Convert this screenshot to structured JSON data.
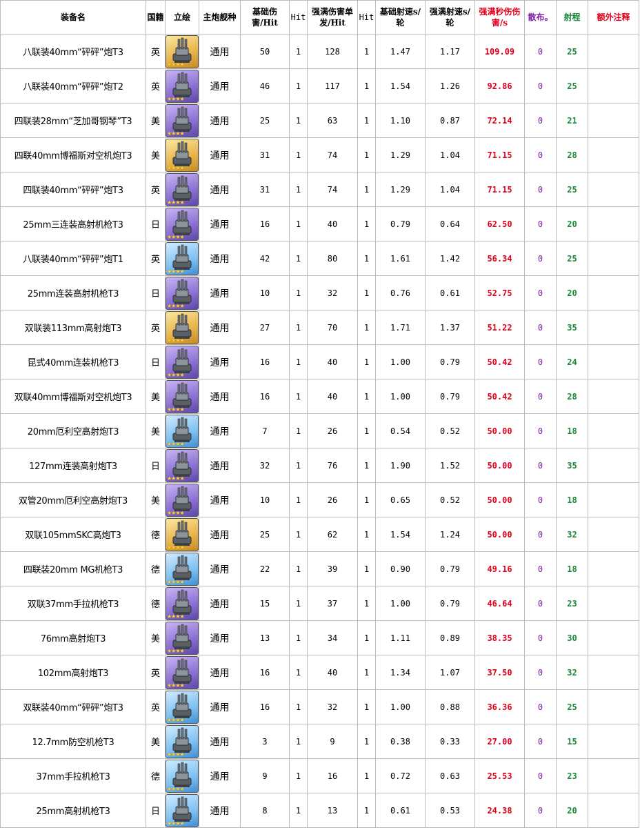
{
  "header": {
    "name": "装备名",
    "nation": "国籍",
    "art": "立绘",
    "ship_type": "主炮舰种",
    "base_damage": "基础伤害/Hit",
    "hit1": "Hit",
    "max_damage": "强满伤害单发/Hit",
    "hit2": "Hit",
    "base_rate": "基础射速s/轮",
    "max_rate": "强满射速s/轮",
    "dps": "强满秒伤伤害/s",
    "spread": "散布。",
    "range": "射程",
    "note": "额外注释"
  },
  "rows": [
    {
      "name": "八联装40mm“砰砰”炮T3",
      "nation": "英",
      "rarity": "gold",
      "type": "通用",
      "base_damage": "50",
      "hit1": "1",
      "max_damage": "128",
      "hit2": "1",
      "base_rate": "1.47",
      "max_rate": "1.17",
      "dps": "109.09",
      "spread": "0",
      "range": "25",
      "note": ""
    },
    {
      "name": "八联装40mm“砰砰”炮T2",
      "nation": "英",
      "rarity": "purple",
      "type": "通用",
      "base_damage": "46",
      "hit1": "1",
      "max_damage": "117",
      "hit2": "1",
      "base_rate": "1.54",
      "max_rate": "1.26",
      "dps": "92.86",
      "spread": "0",
      "range": "25",
      "note": ""
    },
    {
      "name": "四联装28mm“芝加哥钢琴”T3",
      "nation": "美",
      "rarity": "purple",
      "type": "通用",
      "base_damage": "25",
      "hit1": "1",
      "max_damage": "63",
      "hit2": "1",
      "base_rate": "1.10",
      "max_rate": "0.87",
      "dps": "72.14",
      "spread": "0",
      "range": "21",
      "note": ""
    },
    {
      "name": "四联40mm博福斯对空机炮T3",
      "nation": "美",
      "rarity": "gold",
      "type": "通用",
      "base_damage": "31",
      "hit1": "1",
      "max_damage": "74",
      "hit2": "1",
      "base_rate": "1.29",
      "max_rate": "1.04",
      "dps": "71.15",
      "spread": "0",
      "range": "28",
      "note": ""
    },
    {
      "name": "四联装40mm“砰砰”炮T3",
      "nation": "英",
      "rarity": "purple",
      "type": "通用",
      "base_damage": "31",
      "hit1": "1",
      "max_damage": "74",
      "hit2": "1",
      "base_rate": "1.29",
      "max_rate": "1.04",
      "dps": "71.15",
      "spread": "0",
      "range": "25",
      "note": ""
    },
    {
      "name": "25mm三连装高射机枪T3",
      "nation": "日",
      "rarity": "purple",
      "type": "通用",
      "base_damage": "16",
      "hit1": "1",
      "max_damage": "40",
      "hit2": "1",
      "base_rate": "0.79",
      "max_rate": "0.64",
      "dps": "62.50",
      "spread": "0",
      "range": "20",
      "note": ""
    },
    {
      "name": "八联装40mm“砰砰”炮T1",
      "nation": "英",
      "rarity": "blue",
      "type": "通用",
      "base_damage": "42",
      "hit1": "1",
      "max_damage": "80",
      "hit2": "1",
      "base_rate": "1.61",
      "max_rate": "1.42",
      "dps": "56.34",
      "spread": "0",
      "range": "25",
      "note": ""
    },
    {
      "name": "25mm连装高射机枪T3",
      "nation": "日",
      "rarity": "purple",
      "type": "通用",
      "base_damage": "10",
      "hit1": "1",
      "max_damage": "32",
      "hit2": "1",
      "base_rate": "0.76",
      "max_rate": "0.61",
      "dps": "52.75",
      "spread": "0",
      "range": "20",
      "note": ""
    },
    {
      "name": "双联装113mm高射炮T3",
      "nation": "英",
      "rarity": "gold",
      "type": "通用",
      "base_damage": "27",
      "hit1": "1",
      "max_damage": "70",
      "hit2": "1",
      "base_rate": "1.71",
      "max_rate": "1.37",
      "dps": "51.22",
      "spread": "0",
      "range": "35",
      "note": ""
    },
    {
      "name": "昆式40mm连装机枪T3",
      "nation": "日",
      "rarity": "purple",
      "type": "通用",
      "base_damage": "16",
      "hit1": "1",
      "max_damage": "40",
      "hit2": "1",
      "base_rate": "1.00",
      "max_rate": "0.79",
      "dps": "50.42",
      "spread": "0",
      "range": "24",
      "note": ""
    },
    {
      "name": "双联40mm博福斯对空机炮T3",
      "nation": "美",
      "rarity": "purple",
      "type": "通用",
      "base_damage": "16",
      "hit1": "1",
      "max_damage": "40",
      "hit2": "1",
      "base_rate": "1.00",
      "max_rate": "0.79",
      "dps": "50.42",
      "spread": "0",
      "range": "28",
      "note": ""
    },
    {
      "name": "20mm厄利空高射炮T3",
      "nation": "美",
      "rarity": "blue",
      "type": "通用",
      "base_damage": "7",
      "hit1": "1",
      "max_damage": "26",
      "hit2": "1",
      "base_rate": "0.54",
      "max_rate": "0.52",
      "dps": "50.00",
      "spread": "0",
      "range": "18",
      "note": ""
    },
    {
      "name": "127mm连装高射炮T3",
      "nation": "日",
      "rarity": "purple",
      "type": "通用",
      "base_damage": "32",
      "hit1": "1",
      "max_damage": "76",
      "hit2": "1",
      "base_rate": "1.90",
      "max_rate": "1.52",
      "dps": "50.00",
      "spread": "0",
      "range": "35",
      "note": ""
    },
    {
      "name": "双管20mm厄利空高射炮T3",
      "nation": "美",
      "rarity": "purple",
      "type": "通用",
      "base_damage": "10",
      "hit1": "1",
      "max_damage": "26",
      "hit2": "1",
      "base_rate": "0.65",
      "max_rate": "0.52",
      "dps": "50.00",
      "spread": "0",
      "range": "18",
      "note": ""
    },
    {
      "name": "双联105mmSKC高炮T3",
      "nation": "德",
      "rarity": "gold",
      "type": "通用",
      "base_damage": "25",
      "hit1": "1",
      "max_damage": "62",
      "hit2": "1",
      "base_rate": "1.54",
      "max_rate": "1.24",
      "dps": "50.00",
      "spread": "0",
      "range": "32",
      "note": ""
    },
    {
      "name": "四联装20mm MG机枪T3",
      "nation": "德",
      "rarity": "blue",
      "type": "通用",
      "base_damage": "22",
      "hit1": "1",
      "max_damage": "39",
      "hit2": "1",
      "base_rate": "0.90",
      "max_rate": "0.79",
      "dps": "49.16",
      "spread": "0",
      "range": "18",
      "note": ""
    },
    {
      "name": "双联37mm手拉机枪T3",
      "nation": "德",
      "rarity": "purple",
      "type": "通用",
      "base_damage": "15",
      "hit1": "1",
      "max_damage": "37",
      "hit2": "1",
      "base_rate": "1.00",
      "max_rate": "0.79",
      "dps": "46.64",
      "spread": "0",
      "range": "23",
      "note": ""
    },
    {
      "name": "76mm高射炮T3",
      "nation": "美",
      "rarity": "purple",
      "type": "通用",
      "base_damage": "13",
      "hit1": "1",
      "max_damage": "34",
      "hit2": "1",
      "base_rate": "1.11",
      "max_rate": "0.89",
      "dps": "38.35",
      "spread": "0",
      "range": "30",
      "note": ""
    },
    {
      "name": "102mm高射炮T3",
      "nation": "英",
      "rarity": "purple",
      "type": "通用",
      "base_damage": "16",
      "hit1": "1",
      "max_damage": "40",
      "hit2": "1",
      "base_rate": "1.34",
      "max_rate": "1.07",
      "dps": "37.50",
      "spread": "0",
      "range": "32",
      "note": ""
    },
    {
      "name": "双联装40mm“砰砰”炮T3",
      "nation": "英",
      "rarity": "blue",
      "type": "通用",
      "base_damage": "16",
      "hit1": "1",
      "max_damage": "32",
      "hit2": "1",
      "base_rate": "1.00",
      "max_rate": "0.88",
      "dps": "36.36",
      "spread": "0",
      "range": "25",
      "note": ""
    },
    {
      "name": "12.7mm防空机枪T3",
      "nation": "美",
      "rarity": "blue",
      "type": "通用",
      "base_damage": "3",
      "hit1": "1",
      "max_damage": "9",
      "hit2": "1",
      "base_rate": "0.38",
      "max_rate": "0.33",
      "dps": "27.00",
      "spread": "0",
      "range": "15",
      "note": ""
    },
    {
      "name": "37mm手拉机枪T3",
      "nation": "德",
      "rarity": "blue",
      "type": "通用",
      "base_damage": "9",
      "hit1": "1",
      "max_damage": "16",
      "hit2": "1",
      "base_rate": "0.72",
      "max_rate": "0.63",
      "dps": "25.53",
      "spread": "0",
      "range": "23",
      "note": ""
    },
    {
      "name": "25mm高射机枪T3",
      "nation": "日",
      "rarity": "blue",
      "type": "通用",
      "base_damage": "8",
      "hit1": "1",
      "max_damage": "13",
      "hit2": "1",
      "base_rate": "0.61",
      "max_rate": "0.53",
      "dps": "24.38",
      "spread": "0",
      "range": "20",
      "note": ""
    }
  ]
}
